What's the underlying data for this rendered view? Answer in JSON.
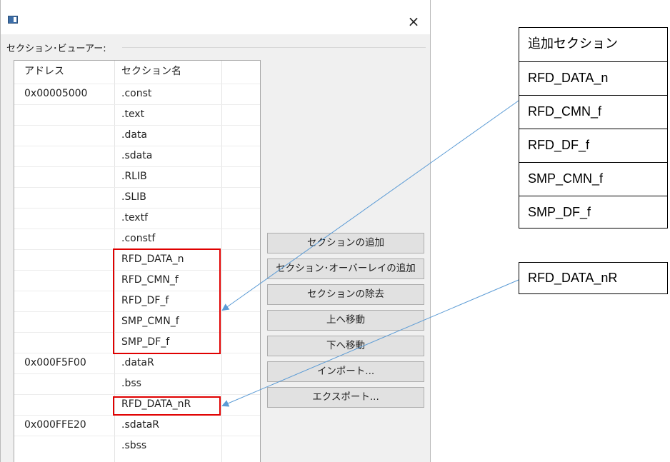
{
  "dialog": {
    "close_glyph": "×",
    "group_label": "セクション･ビューアー:"
  },
  "table": {
    "headers": [
      "アドレス",
      "セクション名"
    ],
    "rows": [
      {
        "address": "0x00005000",
        "section": ".const"
      },
      {
        "address": "",
        "section": ".text"
      },
      {
        "address": "",
        "section": ".data"
      },
      {
        "address": "",
        "section": ".sdata"
      },
      {
        "address": "",
        "section": ".RLIB"
      },
      {
        "address": "",
        "section": ".SLIB"
      },
      {
        "address": "",
        "section": ".textf"
      },
      {
        "address": "",
        "section": ".constf"
      },
      {
        "address": "",
        "section": "RFD_DATA_n"
      },
      {
        "address": "",
        "section": "RFD_CMN_f"
      },
      {
        "address": "",
        "section": "RFD_DF_f"
      },
      {
        "address": "",
        "section": "SMP_CMN_f"
      },
      {
        "address": "",
        "section": "SMP_DF_f"
      },
      {
        "address": "0x000F5F00",
        "section": ".dataR"
      },
      {
        "address": "",
        "section": ".bss"
      },
      {
        "address": "",
        "section": "RFD_DATA_nR"
      },
      {
        "address": "0x000FFE20",
        "section": ".sdataR"
      },
      {
        "address": "",
        "section": ".sbss"
      }
    ]
  },
  "buttons": {
    "add_section": "セクションの追加",
    "add_overlay": "セクション･オーバーレイの追加",
    "remove_section": "セクションの除去",
    "move_up": "上へ移動",
    "move_down": "下へ移動",
    "import": "インポート...",
    "export": "エクスポート..."
  },
  "callout_table": {
    "header": "追加セクション",
    "items": [
      "RFD_DATA_n",
      "RFD_CMN_f",
      "RFD_DF_f",
      "SMP_CMN_f",
      "SMP_DF_f"
    ]
  },
  "callout_single": {
    "item": "RFD_DATA_nR"
  },
  "colors": {
    "highlight": "#e00000",
    "arrow": "#5b9bd5"
  }
}
